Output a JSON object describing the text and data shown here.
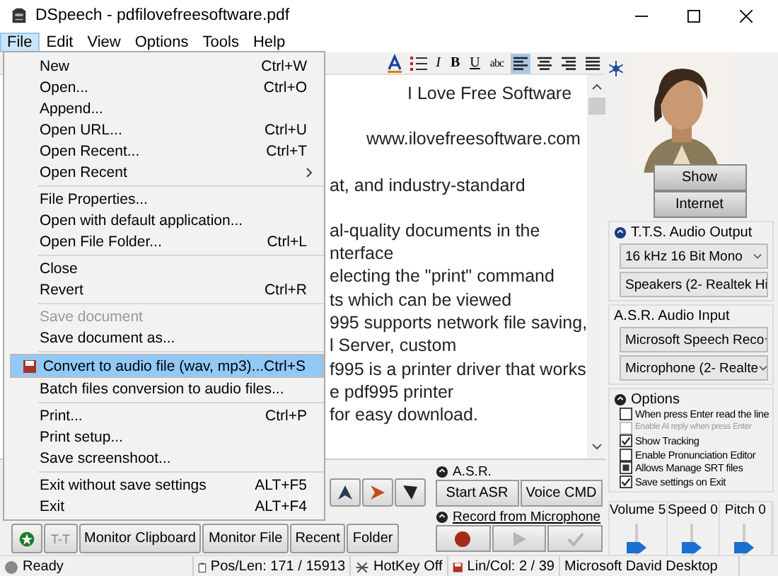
{
  "window": {
    "title": "DSpeech - pdfilovefreesoftware.pdf"
  },
  "menubar": [
    {
      "label": "File",
      "selected": true
    },
    {
      "label": "Edit",
      "selected": false
    },
    {
      "label": "View",
      "selected": false
    },
    {
      "label": "Options",
      "selected": false
    },
    {
      "label": "Tools",
      "selected": false
    },
    {
      "label": "Help",
      "selected": false
    }
  ],
  "toolbar": [
    {
      "kind": "font-color",
      "selected": false
    },
    {
      "kind": "list",
      "selected": false
    },
    {
      "kind": "text",
      "label": "I",
      "selected": false
    },
    {
      "kind": "text",
      "label": "B",
      "selected": false
    },
    {
      "kind": "text",
      "label": "U",
      "selected": false
    },
    {
      "kind": "text",
      "label": "abc",
      "selected": false
    },
    {
      "kind": "align-left",
      "selected": true
    },
    {
      "kind": "align-center",
      "selected": false
    },
    {
      "kind": "align-right",
      "selected": false
    },
    {
      "kind": "justify",
      "selected": false
    }
  ],
  "editor": {
    "lines": [
      "I Love Free Software",
      "www.ilovefreesoftware.com",
      "at, and industry-standard",
      "al-quality documents in the",
      "nterface",
      "electing the \"print\" command",
      "ts which can be viewed",
      "995 supports network file saving,",
      "l Server, custom",
      "f995 is a printer driver that works",
      "e pdf995 printer",
      "for easy download."
    ]
  },
  "file_menu": [
    {
      "kind": "item",
      "label": "New",
      "shortcut": "Ctrl+W",
      "disabled": false,
      "selected": false
    },
    {
      "kind": "item",
      "label": "Open...",
      "shortcut": "Ctrl+O",
      "disabled": false,
      "selected": false
    },
    {
      "kind": "item",
      "label": "Append...",
      "disabled": false,
      "selected": false
    },
    {
      "kind": "item",
      "label": "Open URL...",
      "shortcut": "Ctrl+U",
      "disabled": false,
      "selected": false
    },
    {
      "kind": "item",
      "label": "Open Recent...",
      "shortcut": "Ctrl+T",
      "disabled": false,
      "selected": false
    },
    {
      "kind": "submenu",
      "label": "Open Recent",
      "disabled": false,
      "selected": false
    },
    {
      "kind": "separator"
    },
    {
      "kind": "item",
      "label": "File Properties...",
      "disabled": false,
      "selected": false
    },
    {
      "kind": "item",
      "label": "Open with default application...",
      "disabled": false,
      "selected": false
    },
    {
      "kind": "item",
      "label": "Open File Folder...",
      "shortcut": "Ctrl+L",
      "disabled": false,
      "selected": false
    },
    {
      "kind": "separator"
    },
    {
      "kind": "item",
      "label": "Close",
      "disabled": false,
      "selected": false
    },
    {
      "kind": "item",
      "label": "Revert",
      "shortcut": "Ctrl+R",
      "disabled": false,
      "selected": false
    },
    {
      "kind": "separator"
    },
    {
      "kind": "item",
      "label": "Save document",
      "disabled": true,
      "selected": false
    },
    {
      "kind": "item",
      "label": "Save document as...",
      "disabled": false,
      "selected": false
    },
    {
      "kind": "separator"
    },
    {
      "kind": "item-with-icon",
      "label": "Convert to audio file (wav, mp3)...",
      "shortcut": "Ctrl+S",
      "disabled": false,
      "selected": true
    },
    {
      "kind": "item",
      "label": "Batch files conversion to audio files...",
      "disabled": false,
      "selected": false
    },
    {
      "kind": "separator"
    },
    {
      "kind": "item",
      "label": "Print...",
      "shortcut": "Ctrl+P",
      "disabled": false,
      "selected": false
    },
    {
      "kind": "item",
      "label": "Print setup...",
      "disabled": false,
      "selected": false
    },
    {
      "kind": "item",
      "label": "Save screenshoot...",
      "disabled": false,
      "selected": false
    },
    {
      "kind": "separator"
    },
    {
      "kind": "item",
      "label": "Exit without save settings",
      "shortcut": "ALT+F5",
      "disabled": false,
      "selected": false
    },
    {
      "kind": "item",
      "label": "Exit",
      "shortcut": "ALT+F4",
      "disabled": false,
      "selected": false
    }
  ],
  "nav_buttons": [
    {
      "kind": "up"
    },
    {
      "kind": "right"
    },
    {
      "kind": "down"
    }
  ],
  "bottom_buttons": [
    {
      "kind": "star"
    },
    {
      "kind": "tt",
      "label": "T-T"
    },
    {
      "kind": "text",
      "label": "Monitor Clipboard"
    },
    {
      "kind": "text",
      "label": "Monitor File"
    },
    {
      "kind": "text",
      "label": "Recent"
    },
    {
      "kind": "text",
      "label": "Folder"
    }
  ],
  "asr": {
    "title": "A.S.R.",
    "buttons": [
      "Start ASR",
      "Voice CMD"
    ],
    "record_title": "Record from Microphone",
    "record_buttons": [
      {
        "kind": "record",
        "disabled": false
      },
      {
        "kind": "play",
        "disabled": true
      },
      {
        "kind": "check",
        "disabled": true
      }
    ]
  },
  "side": {
    "buttons": [
      "Show",
      "Internet"
    ],
    "tts": {
      "title": "T.T.S. Audio Output",
      "selects": [
        "16 kHz 16 Bit Mono",
        "Speakers (2- Realtek Hi"
      ]
    },
    "asr_input": {
      "title": "A.S.R. Audio Input",
      "selects": [
        "Microsoft Speech Reco",
        "Microphone (2- Realte"
      ]
    },
    "options": {
      "title": "Options",
      "items": [
        {
          "label": "When press Enter read the line",
          "checked": false,
          "mixed": false,
          "disabled": false
        },
        {
          "label": "Enable AI reply when press Enter",
          "checked": false,
          "mixed": false,
          "disabled": true
        },
        {
          "label": "Show Tracking",
          "checked": true,
          "mixed": false,
          "disabled": false
        },
        {
          "label": "Enable Pronunciation Editor",
          "checked": false,
          "mixed": false,
          "disabled": false
        },
        {
          "label": "Allows Manage SRT files",
          "checked": false,
          "mixed": true,
          "disabled": false
        },
        {
          "label": "Save settings on Exit",
          "checked": true,
          "mixed": false,
          "disabled": false
        }
      ]
    },
    "sliders": [
      {
        "label": "Volume 5",
        "level": 0.5
      },
      {
        "label": "Speed 0",
        "level": 0.5
      },
      {
        "label": "Pitch 0",
        "level": 0.5
      }
    ]
  },
  "status_bar": {
    "status": "Ready",
    "position": "Pos/Len: 171 / 15913",
    "hotkey": "HotKey Off",
    "line_col": "Lin/Col: 2 / 39",
    "voice": "Microsoft David Desktop"
  }
}
